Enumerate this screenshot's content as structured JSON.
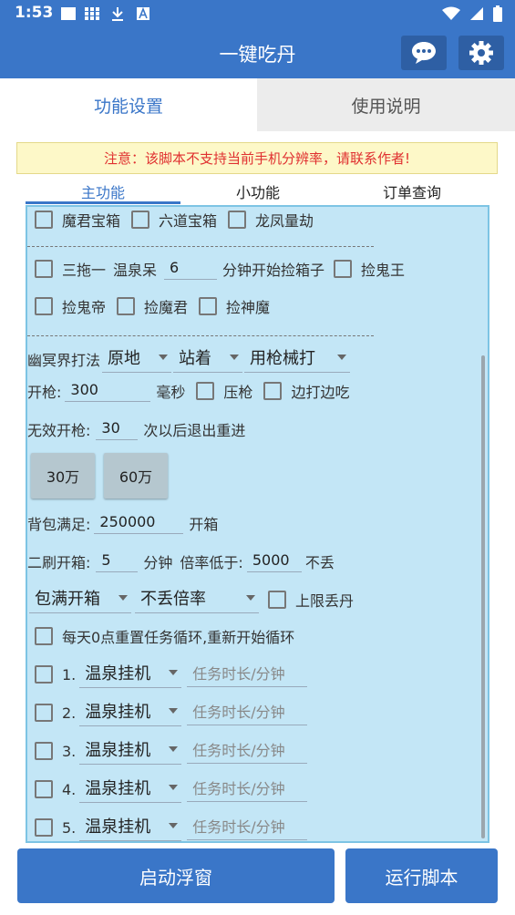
{
  "status_bar": {
    "time": "1:53"
  },
  "app": {
    "title": "一键吃丹"
  },
  "top_tabs": [
    "功能设置",
    "使用说明"
  ],
  "notice": "注意：该脚本不支持当前手机分辨率，请联系作者!",
  "sub_tabs": [
    "主功能",
    "小功能",
    "订单查询"
  ],
  "row1": [
    "魔君宝箱",
    "六道宝箱",
    "龙凤量劫"
  ],
  "row2": {
    "cb1": "三拖一",
    "label": "温泉呆",
    "minutes": "6",
    "suffix": "分钟开始捡箱子",
    "cb2": "捡鬼王"
  },
  "row3": [
    "捡鬼帝",
    "捡魔君",
    "捡神魔"
  ],
  "row4": {
    "label": "幽冥界打法",
    "spin1": "原地",
    "spin2": "站着",
    "spin3": "用枪械打"
  },
  "row5": {
    "label": "开枪:",
    "value": "300",
    "unit": "毫秒",
    "cb1": "压枪",
    "cb2": "边打边吃"
  },
  "row6": {
    "label": "无效开枪:",
    "value": "30",
    "suffix": "次以后退出重进"
  },
  "buttons": {
    "b1": "30万",
    "b2": "60万"
  },
  "row7": {
    "label": "背包满足:",
    "value": "250000",
    "suffix": "开箱"
  },
  "row8": {
    "label": "二刷开箱:",
    "value": "5",
    "unit": "分钟",
    "label2": "倍率低于:",
    "value2": "5000",
    "suffix": "不丢"
  },
  "row9": {
    "spin1": "包满开箱",
    "spin2": "不丢倍率",
    "cb": "上限丢丹"
  },
  "row10": "每天0点重置任务循环,重新开始循环",
  "tasks": [
    {
      "num": "1.",
      "spinner": "温泉挂机",
      "placeholder": "任务时长/分钟"
    },
    {
      "num": "2.",
      "spinner": "温泉挂机",
      "placeholder": "任务时长/分钟"
    },
    {
      "num": "3.",
      "spinner": "温泉挂机",
      "placeholder": "任务时长/分钟"
    },
    {
      "num": "4.",
      "spinner": "温泉挂机",
      "placeholder": "任务时长/分钟"
    },
    {
      "num": "5.",
      "spinner": "温泉挂机",
      "placeholder": "任务时长/分钟"
    }
  ],
  "bottom": {
    "left": "启动浮窗",
    "right": "运行脚本"
  },
  "colors": {
    "primary": "#3a76c8",
    "panel": "#c3e6f6",
    "notice_text": "#e03030"
  }
}
